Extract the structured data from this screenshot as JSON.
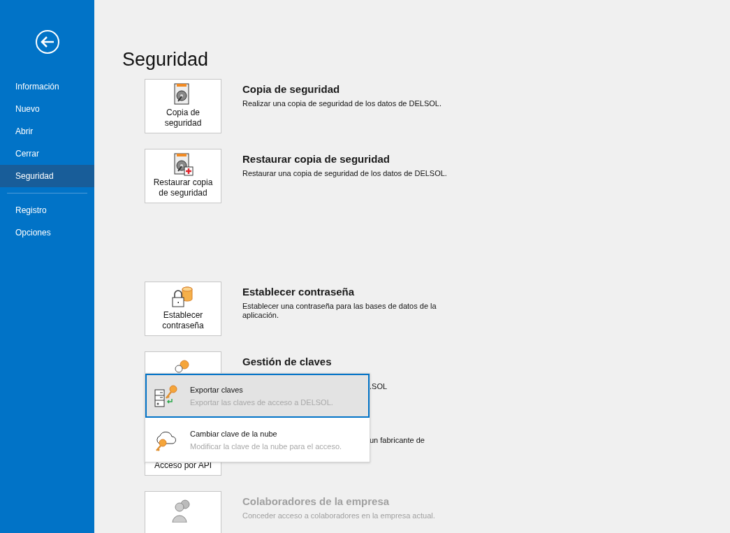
{
  "sidebar": {
    "groups": [
      [
        {
          "label": "Información",
          "selected": false
        },
        {
          "label": "Nuevo",
          "selected": false
        },
        {
          "label": "Abrir",
          "selected": false
        },
        {
          "label": "Cerrar",
          "selected": false
        },
        {
          "label": "Seguridad",
          "selected": true
        }
      ],
      [
        {
          "label": "Registro",
          "selected": false
        },
        {
          "label": "Opciones",
          "selected": false
        }
      ]
    ]
  },
  "page_title": "Seguridad",
  "section_groups": [
    [
      {
        "kind": "backup",
        "button_label": "Copia de seguridad",
        "title": "Copia de seguridad",
        "description": "Realizar una copia de seguridad de los datos de DELSOL.",
        "disabled": false,
        "covered": false
      },
      {
        "kind": "restore",
        "button_label": "Restaurar copia de seguridad",
        "title": "Restaurar copia de seguridad",
        "description": "Restaurar una copia de seguridad de los datos de DELSOL.",
        "disabled": false,
        "covered": false
      }
    ],
    [
      {
        "kind": "password",
        "button_label": "Establecer contraseña",
        "title": "Establecer contraseña",
        "description": "Establecer una contraseña para las bases de datos de la aplicación.",
        "disabled": false,
        "covered": false
      },
      {
        "kind": "keys",
        "title": "Gestión de claves",
        "description": ".SOL",
        "disabled": false,
        "covered": true,
        "dropdown": {
          "items": [
            {
              "kind": "export",
              "title": "Exportar claves",
              "subtitle": "Exportar las claves de acceso a DELSOL.",
              "selected": true
            },
            {
              "kind": "cloud",
              "title": "Cambiar clave de la nube",
              "subtitle": "Modificar la clave de la nube para el acceso.",
              "selected": false
            }
          ]
        }
      },
      {
        "kind": "blank",
        "button_label": "Acceso por API",
        "description": "un fabricante de",
        "disabled": false,
        "covered": true
      },
      {
        "kind": "team",
        "title": "Colaboradores de la empresa",
        "description": "Conceder acceso a colaboradores en la empresa actual.",
        "disabled": true,
        "covered": false
      }
    ]
  ]
}
